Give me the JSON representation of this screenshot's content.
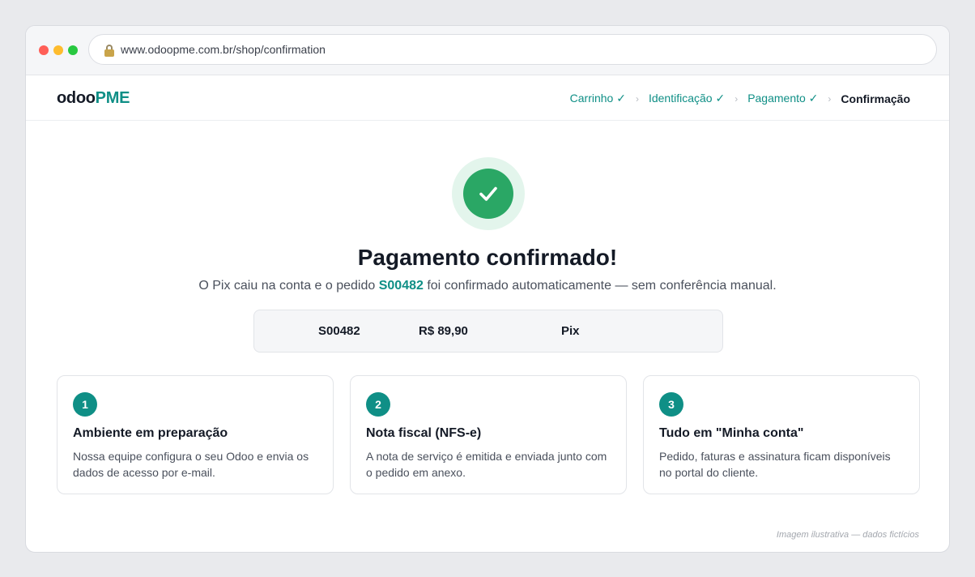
{
  "browser": {
    "url": "www.odoopme.com.br/shop/confirmation"
  },
  "header": {
    "logo_part1": "odoo",
    "logo_part2": "PME",
    "steps": [
      {
        "label": "Carrinho ✓"
      },
      {
        "label": "Identificação ✓"
      },
      {
        "label": "Pagamento ✓"
      },
      {
        "label": "Confirmação"
      }
    ],
    "separator": "›"
  },
  "confirmation": {
    "title": "Pagamento confirmado!",
    "subtitle_before": "O Pix caiu na conta e o pedido ",
    "order_number": "S00482",
    "subtitle_after": " foi confirmado automaticamente — sem conferência manual."
  },
  "summary": {
    "order": "S00482",
    "amount": "R$ 89,90",
    "method": "Pix"
  },
  "cards": [
    {
      "number": "1",
      "title": "Ambiente em preparação",
      "description": "Nossa equipe configura o seu Odoo e envia os dados de acesso por e-mail."
    },
    {
      "number": "2",
      "title": "Nota fiscal (NFS-e)",
      "description": "A nota de serviço é emitida e enviada junto com o pedido em anexo."
    },
    {
      "number": "3",
      "title": "Tudo em \"Minha conta\"",
      "description": "Pedido, faturas e assinatura ficam disponíveis no portal do cliente."
    }
  ],
  "footer_note": "Imagem ilustrativa — dados fictícios",
  "colors": {
    "brand": "#0f8f86",
    "success": "#2aa765",
    "success_halo": "#e3f5ec"
  }
}
